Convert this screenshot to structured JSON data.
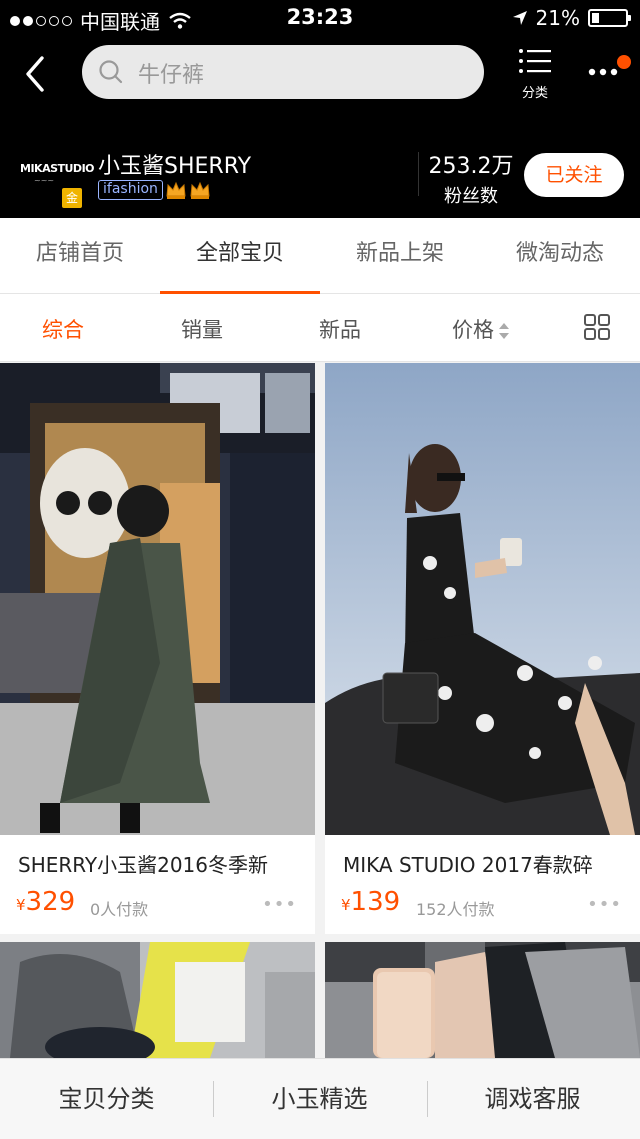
{
  "status_bar": {
    "carrier": "中国联通",
    "time": "23:23",
    "battery": "21%",
    "battery_level": 0.21
  },
  "nav": {
    "search_placeholder": "牛仔裤",
    "category_label": "分类"
  },
  "shop": {
    "logo_text": "MIKASTUDIO",
    "gold_badge": "金",
    "name": "小玉酱SHERRY",
    "badge": "ifashion",
    "fans_count": "253.2万",
    "fans_label": "粉丝数",
    "follow_label": "已关注"
  },
  "tabs": [
    {
      "label": "店铺首页"
    },
    {
      "label": "全部宝贝",
      "active": true
    },
    {
      "label": "新品上架"
    },
    {
      "label": "微淘动态"
    }
  ],
  "sort": {
    "items": [
      {
        "label": "综合",
        "active": true
      },
      {
        "label": "销量"
      },
      {
        "label": "新品"
      },
      {
        "label": "价格"
      }
    ]
  },
  "products": [
    {
      "title": "SHERRY小玉酱2016冬季新",
      "currency": "¥",
      "price": "329",
      "sold": "0人付款",
      "more": "•••"
    },
    {
      "title": "MIKA STUDIO 2017春款碎",
      "currency": "¥",
      "price": "139",
      "sold": "152人付款",
      "more": "•••"
    }
  ],
  "bottom_bar": {
    "items": [
      {
        "label": "宝贝分类"
      },
      {
        "label": "小玉精选"
      },
      {
        "label": "调戏客服"
      }
    ]
  },
  "colors": {
    "accent": "#ff5000",
    "header_bg": "#000000"
  }
}
